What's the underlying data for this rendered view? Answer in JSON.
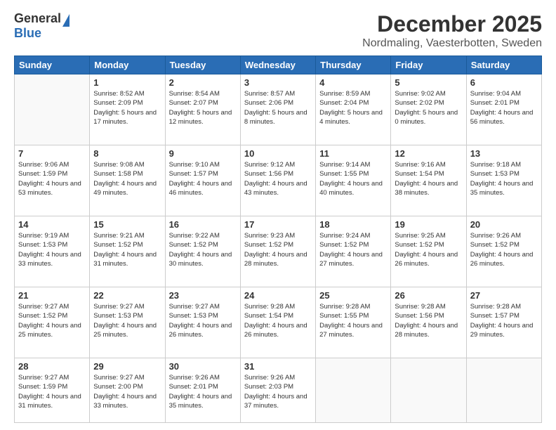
{
  "logo": {
    "general": "General",
    "blue": "Blue"
  },
  "title": "December 2025",
  "subtitle": "Nordmaling, Vaesterbotten, Sweden",
  "days": [
    "Sunday",
    "Monday",
    "Tuesday",
    "Wednesday",
    "Thursday",
    "Friday",
    "Saturday"
  ],
  "weeks": [
    [
      {
        "day": "",
        "info": ""
      },
      {
        "day": "1",
        "info": "Sunrise: 8:52 AM\nSunset: 2:09 PM\nDaylight: 5 hours\nand 17 minutes."
      },
      {
        "day": "2",
        "info": "Sunrise: 8:54 AM\nSunset: 2:07 PM\nDaylight: 5 hours\nand 12 minutes."
      },
      {
        "day": "3",
        "info": "Sunrise: 8:57 AM\nSunset: 2:06 PM\nDaylight: 5 hours\nand 8 minutes."
      },
      {
        "day": "4",
        "info": "Sunrise: 8:59 AM\nSunset: 2:04 PM\nDaylight: 5 hours\nand 4 minutes."
      },
      {
        "day": "5",
        "info": "Sunrise: 9:02 AM\nSunset: 2:02 PM\nDaylight: 5 hours\nand 0 minutes."
      },
      {
        "day": "6",
        "info": "Sunrise: 9:04 AM\nSunset: 2:01 PM\nDaylight: 4 hours\nand 56 minutes."
      }
    ],
    [
      {
        "day": "7",
        "info": "Sunrise: 9:06 AM\nSunset: 1:59 PM\nDaylight: 4 hours\nand 53 minutes."
      },
      {
        "day": "8",
        "info": "Sunrise: 9:08 AM\nSunset: 1:58 PM\nDaylight: 4 hours\nand 49 minutes."
      },
      {
        "day": "9",
        "info": "Sunrise: 9:10 AM\nSunset: 1:57 PM\nDaylight: 4 hours\nand 46 minutes."
      },
      {
        "day": "10",
        "info": "Sunrise: 9:12 AM\nSunset: 1:56 PM\nDaylight: 4 hours\nand 43 minutes."
      },
      {
        "day": "11",
        "info": "Sunrise: 9:14 AM\nSunset: 1:55 PM\nDaylight: 4 hours\nand 40 minutes."
      },
      {
        "day": "12",
        "info": "Sunrise: 9:16 AM\nSunset: 1:54 PM\nDaylight: 4 hours\nand 38 minutes."
      },
      {
        "day": "13",
        "info": "Sunrise: 9:18 AM\nSunset: 1:53 PM\nDaylight: 4 hours\nand 35 minutes."
      }
    ],
    [
      {
        "day": "14",
        "info": "Sunrise: 9:19 AM\nSunset: 1:53 PM\nDaylight: 4 hours\nand 33 minutes."
      },
      {
        "day": "15",
        "info": "Sunrise: 9:21 AM\nSunset: 1:52 PM\nDaylight: 4 hours\nand 31 minutes."
      },
      {
        "day": "16",
        "info": "Sunrise: 9:22 AM\nSunset: 1:52 PM\nDaylight: 4 hours\nand 30 minutes."
      },
      {
        "day": "17",
        "info": "Sunrise: 9:23 AM\nSunset: 1:52 PM\nDaylight: 4 hours\nand 28 minutes."
      },
      {
        "day": "18",
        "info": "Sunrise: 9:24 AM\nSunset: 1:52 PM\nDaylight: 4 hours\nand 27 minutes."
      },
      {
        "day": "19",
        "info": "Sunrise: 9:25 AM\nSunset: 1:52 PM\nDaylight: 4 hours\nand 26 minutes."
      },
      {
        "day": "20",
        "info": "Sunrise: 9:26 AM\nSunset: 1:52 PM\nDaylight: 4 hours\nand 26 minutes."
      }
    ],
    [
      {
        "day": "21",
        "info": "Sunrise: 9:27 AM\nSunset: 1:52 PM\nDaylight: 4 hours\nand 25 minutes."
      },
      {
        "day": "22",
        "info": "Sunrise: 9:27 AM\nSunset: 1:53 PM\nDaylight: 4 hours\nand 25 minutes."
      },
      {
        "day": "23",
        "info": "Sunrise: 9:27 AM\nSunset: 1:53 PM\nDaylight: 4 hours\nand 26 minutes."
      },
      {
        "day": "24",
        "info": "Sunrise: 9:28 AM\nSunset: 1:54 PM\nDaylight: 4 hours\nand 26 minutes."
      },
      {
        "day": "25",
        "info": "Sunrise: 9:28 AM\nSunset: 1:55 PM\nDaylight: 4 hours\nand 27 minutes."
      },
      {
        "day": "26",
        "info": "Sunrise: 9:28 AM\nSunset: 1:56 PM\nDaylight: 4 hours\nand 28 minutes."
      },
      {
        "day": "27",
        "info": "Sunrise: 9:28 AM\nSunset: 1:57 PM\nDaylight: 4 hours\nand 29 minutes."
      }
    ],
    [
      {
        "day": "28",
        "info": "Sunrise: 9:27 AM\nSunset: 1:59 PM\nDaylight: 4 hours\nand 31 minutes."
      },
      {
        "day": "29",
        "info": "Sunrise: 9:27 AM\nSunset: 2:00 PM\nDaylight: 4 hours\nand 33 minutes."
      },
      {
        "day": "30",
        "info": "Sunrise: 9:26 AM\nSunset: 2:01 PM\nDaylight: 4 hours\nand 35 minutes."
      },
      {
        "day": "31",
        "info": "Sunrise: 9:26 AM\nSunset: 2:03 PM\nDaylight: 4 hours\nand 37 minutes."
      },
      {
        "day": "",
        "info": ""
      },
      {
        "day": "",
        "info": ""
      },
      {
        "day": "",
        "info": ""
      }
    ]
  ]
}
